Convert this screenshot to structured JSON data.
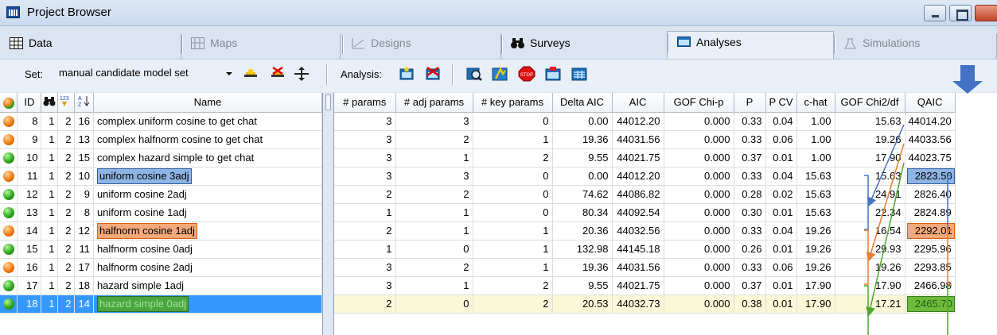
{
  "window": {
    "title": "Project Browser"
  },
  "tabs": [
    {
      "label": "Data",
      "icon": "data-table-icon",
      "dim": false
    },
    {
      "label": "Maps",
      "icon": "map-icon",
      "dim": true
    },
    {
      "label": "Designs",
      "icon": "design-icon",
      "dim": true
    },
    {
      "label": "Surveys",
      "icon": "binoculars-icon",
      "dim": false
    },
    {
      "label": "Analyses",
      "icon": "analysis-icon",
      "dim": false,
      "active": true
    },
    {
      "label": "Simulations",
      "icon": "simulation-icon",
      "dim": true
    }
  ],
  "toolbar": {
    "set_label": "Set:",
    "set_value": "manual candidate model set",
    "analysis_label": "Analysis:"
  },
  "left_grid": {
    "columns": [
      "ID",
      "Name"
    ],
    "rows": [
      {
        "status": "orange",
        "id": "8",
        "c1": "1",
        "c2": "2",
        "c3": "16",
        "name": "complex uniform cosine to get chat",
        "hl": ""
      },
      {
        "status": "orange",
        "id": "9",
        "c1": "1",
        "c2": "2",
        "c3": "13",
        "name": "complex halfnorm cosine to get chat",
        "hl": ""
      },
      {
        "status": "green",
        "id": "10",
        "c1": "1",
        "c2": "2",
        "c3": "15",
        "name": "complex hazard simple to get chat",
        "hl": ""
      },
      {
        "status": "orange",
        "id": "11",
        "c1": "1",
        "c2": "2",
        "c3": "10",
        "name": "uniform cosine 3adj",
        "hl": "blue"
      },
      {
        "status": "green",
        "id": "12",
        "c1": "1",
        "c2": "2",
        "c3": "9",
        "name": "uniform cosine 2adj",
        "hl": ""
      },
      {
        "status": "green",
        "id": "13",
        "c1": "1",
        "c2": "2",
        "c3": "8",
        "name": "uniform cosine 1adj",
        "hl": ""
      },
      {
        "status": "orange",
        "id": "14",
        "c1": "1",
        "c2": "2",
        "c3": "12",
        "name": "halfnorm cosine 1adj",
        "hl": "orange"
      },
      {
        "status": "green",
        "id": "15",
        "c1": "1",
        "c2": "2",
        "c3": "11",
        "name": "halfnorm cosine 0adj",
        "hl": ""
      },
      {
        "status": "orange",
        "id": "16",
        "c1": "1",
        "c2": "2",
        "c3": "17",
        "name": "halfnorm cosine 2adj",
        "hl": ""
      },
      {
        "status": "green",
        "id": "17",
        "c1": "1",
        "c2": "2",
        "c3": "18",
        "name": "hazard simple 1adj",
        "hl": ""
      },
      {
        "status": "green",
        "id": "18",
        "c1": "1",
        "c2": "2",
        "c3": "14",
        "name": "hazard simple 0adj",
        "hl": "green",
        "selected": true
      }
    ]
  },
  "right_grid": {
    "columns": [
      "# params",
      "# adj params",
      "# key params",
      "Delta AIC",
      "AIC",
      "GOF Chi-p",
      "P",
      "P CV",
      "c-hat",
      "GOF Chi2/df",
      "QAIC"
    ],
    "rows": [
      [
        "3",
        "3",
        "0",
        "0.00",
        "44012.20",
        "0.000",
        "0.33",
        "0.04",
        "1.00",
        "15.63",
        "44014.20"
      ],
      [
        "3",
        "2",
        "1",
        "19.36",
        "44031.56",
        "0.000",
        "0.33",
        "0.06",
        "1.00",
        "19.26",
        "44033.56"
      ],
      [
        "3",
        "1",
        "2",
        "9.55",
        "44021.75",
        "0.000",
        "0.37",
        "0.01",
        "1.00",
        "17.90",
        "44023.75"
      ],
      [
        "3",
        "3",
        "0",
        "0.00",
        "44012.20",
        "0.000",
        "0.33",
        "0.04",
        "15.63",
        "15.63",
        "2823.50"
      ],
      [
        "2",
        "2",
        "0",
        "74.62",
        "44086.82",
        "0.000",
        "0.28",
        "0.02",
        "15.63",
        "24.91",
        "2826.40"
      ],
      [
        "1",
        "1",
        "0",
        "80.34",
        "44092.54",
        "0.000",
        "0.30",
        "0.01",
        "15.63",
        "22.34",
        "2824.89"
      ],
      [
        "2",
        "1",
        "1",
        "20.36",
        "44032.56",
        "0.000",
        "0.33",
        "0.04",
        "19.26",
        "16.54",
        "2292.01"
      ],
      [
        "1",
        "0",
        "1",
        "132.98",
        "44145.18",
        "0.000",
        "0.26",
        "0.01",
        "19.26",
        "29.93",
        "2295.96"
      ],
      [
        "3",
        "2",
        "1",
        "19.36",
        "44031.56",
        "0.000",
        "0.33",
        "0.06",
        "19.26",
        "19.26",
        "2293.85"
      ],
      [
        "3",
        "1",
        "2",
        "9.55",
        "44021.75",
        "0.000",
        "0.37",
        "0.01",
        "17.90",
        "17.90",
        "2466.98"
      ],
      [
        "2",
        "0",
        "2",
        "20.53",
        "44032.73",
        "0.000",
        "0.38",
        "0.01",
        "17.90",
        "17.21",
        "2465.70"
      ]
    ],
    "qaic_highlights": {
      "3": "blue",
      "6": "orange",
      "10": "green"
    }
  },
  "annotation_colors": {
    "blue": "#4472c4",
    "orange": "#ed7d31",
    "green": "#4ea72e"
  }
}
